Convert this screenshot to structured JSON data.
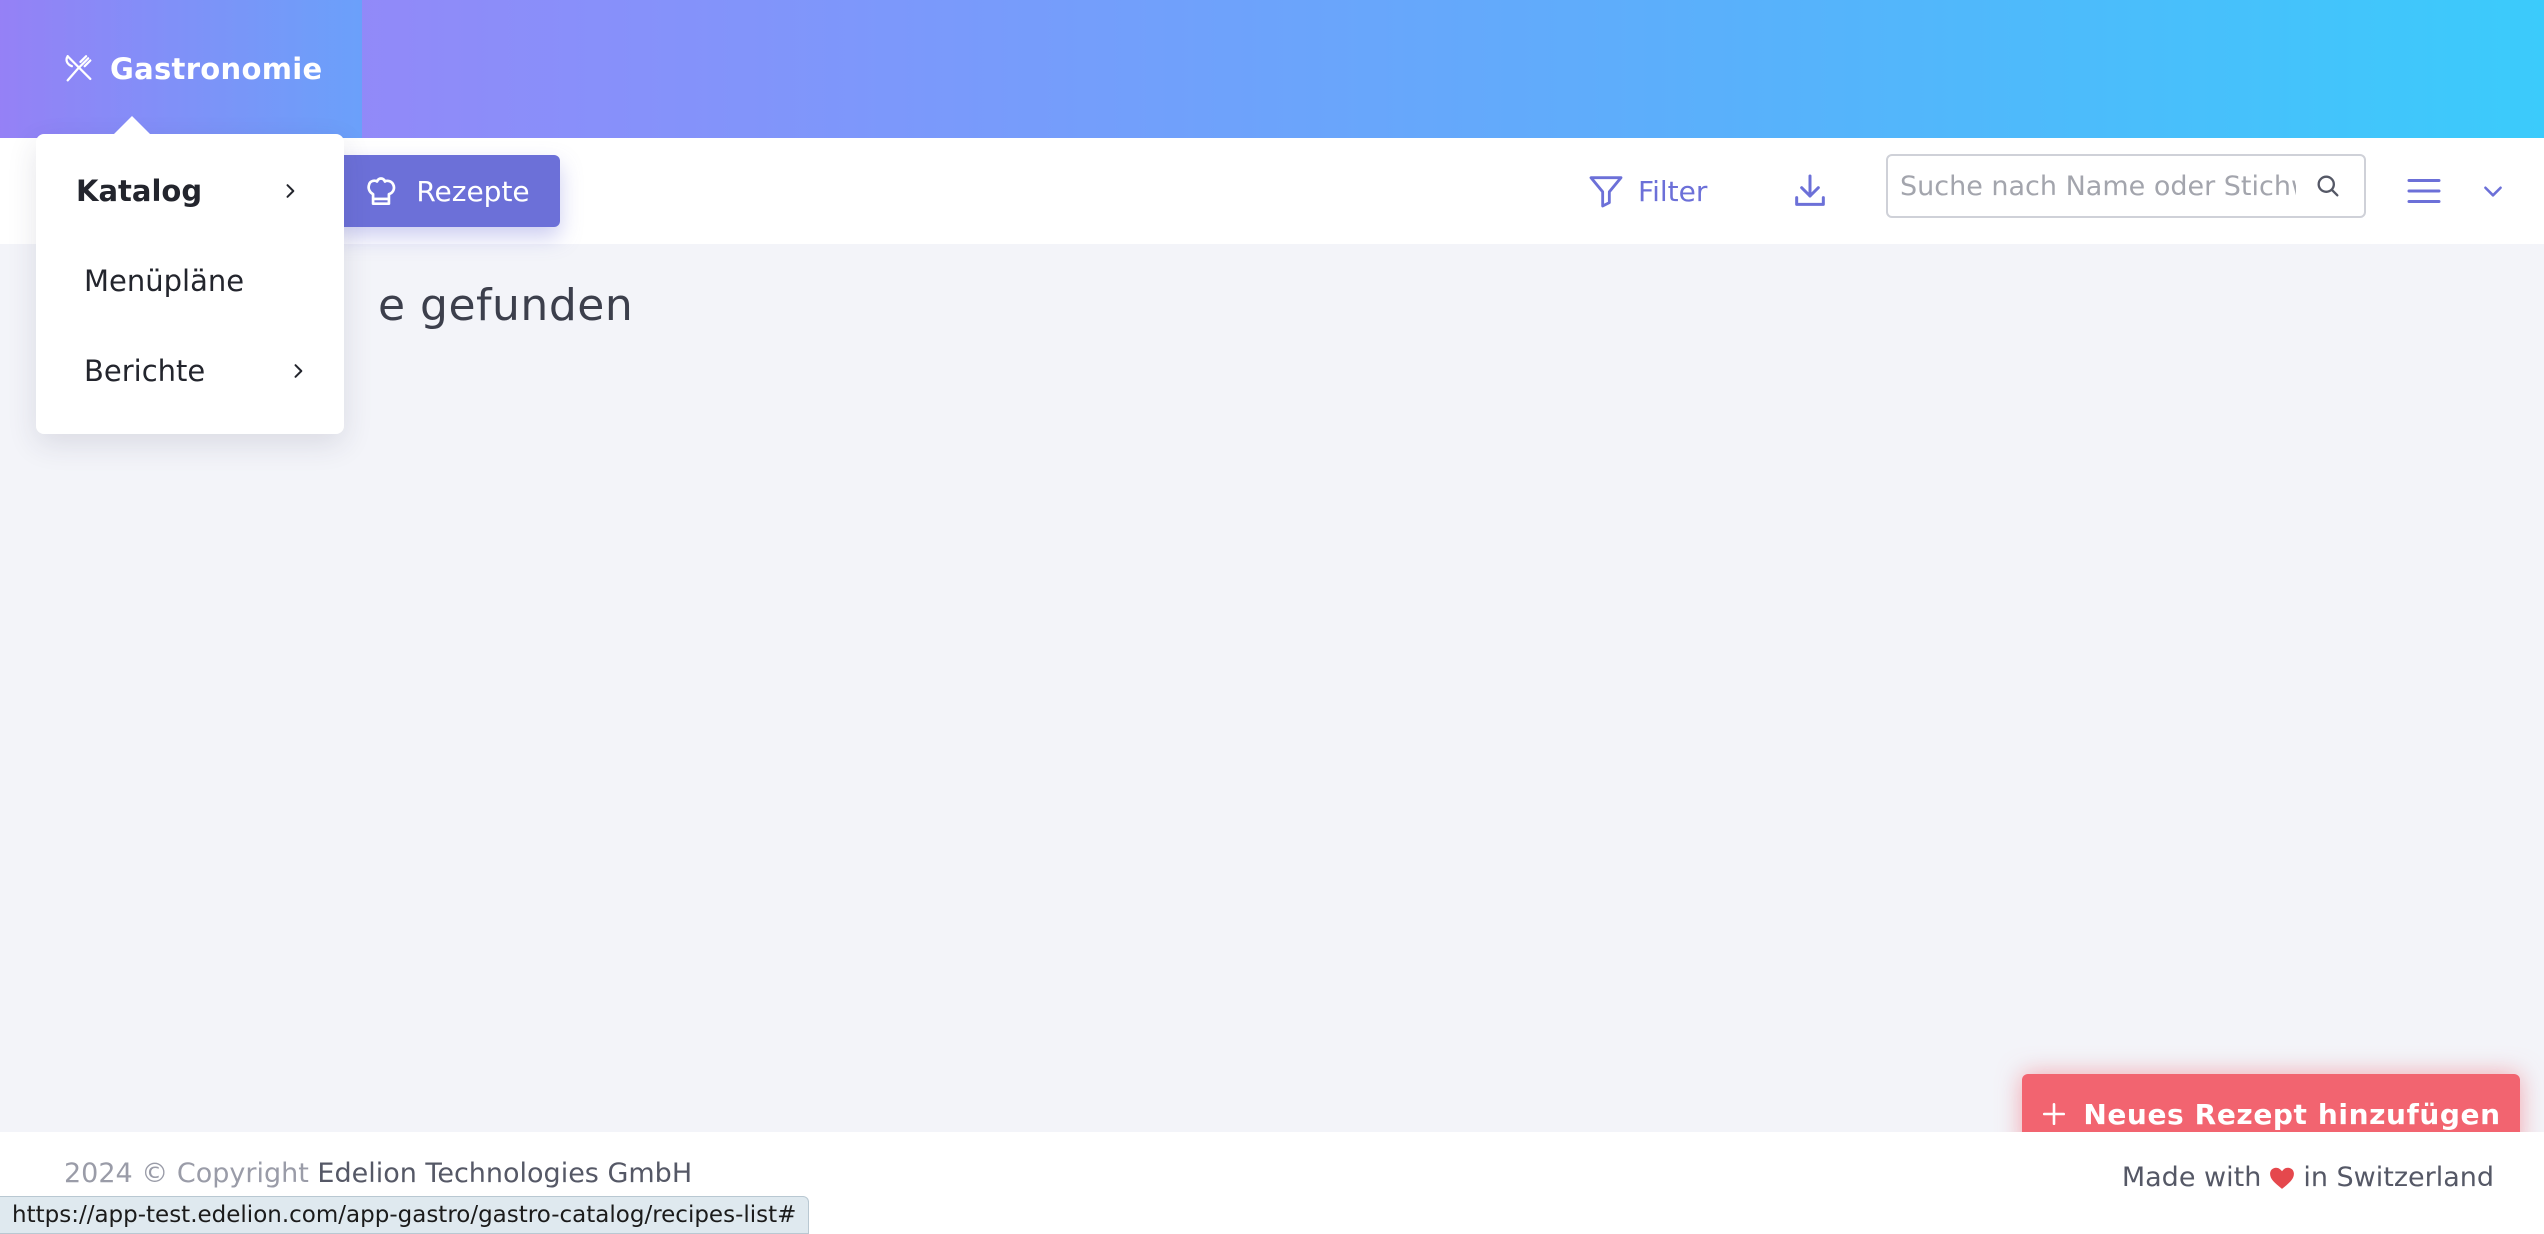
{
  "brand": {
    "label": "Gastronomie",
    "icon": "utensils-icon"
  },
  "toolbar": {
    "rezepte_label": "Rezepte",
    "filter_label": "Filter",
    "search_placeholder": "Suche nach Name oder Stichwort",
    "accent_color": "#6c70d8"
  },
  "content": {
    "heading_visible": "e gefunden"
  },
  "dropdown": {
    "items": [
      {
        "label": "Katalog",
        "has_submenu": true,
        "active": true
      },
      {
        "label": "Menüpläne",
        "has_submenu": false,
        "active": false
      },
      {
        "label": "Berichte",
        "has_submenu": true,
        "active": false
      }
    ]
  },
  "fab": {
    "label": "Neues Rezept hinzufügen",
    "color": "#f26470"
  },
  "footer": {
    "copyright": "2024 © Copyright",
    "company": "Edelion Technologies GmbH",
    "made_prefix": "Made with",
    "made_suffix": "in Switzerland"
  },
  "status_bar": {
    "url": "https://app-test.edelion.com/app-gastro/gastro-catalog/recipes-list#"
  }
}
